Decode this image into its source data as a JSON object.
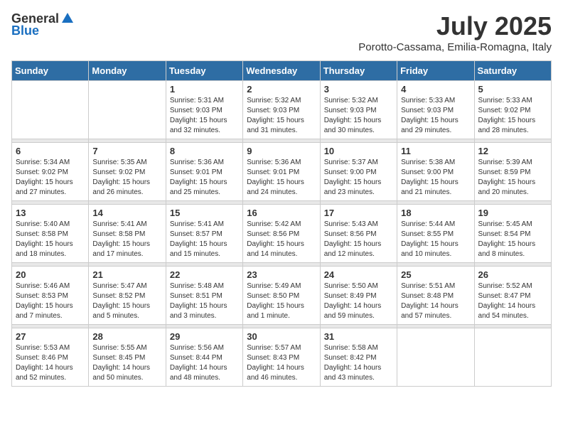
{
  "header": {
    "logo_general": "General",
    "logo_blue": "Blue",
    "month_year": "July 2025",
    "location": "Porotto-Cassama, Emilia-Romagna, Italy"
  },
  "weekdays": [
    "Sunday",
    "Monday",
    "Tuesday",
    "Wednesday",
    "Thursday",
    "Friday",
    "Saturday"
  ],
  "weeks": [
    [
      {
        "day": "",
        "sunrise": "",
        "sunset": "",
        "daylight": ""
      },
      {
        "day": "",
        "sunrise": "",
        "sunset": "",
        "daylight": ""
      },
      {
        "day": "1",
        "sunrise": "Sunrise: 5:31 AM",
        "sunset": "Sunset: 9:03 PM",
        "daylight": "Daylight: 15 hours and 32 minutes."
      },
      {
        "day": "2",
        "sunrise": "Sunrise: 5:32 AM",
        "sunset": "Sunset: 9:03 PM",
        "daylight": "Daylight: 15 hours and 31 minutes."
      },
      {
        "day": "3",
        "sunrise": "Sunrise: 5:32 AM",
        "sunset": "Sunset: 9:03 PM",
        "daylight": "Daylight: 15 hours and 30 minutes."
      },
      {
        "day": "4",
        "sunrise": "Sunrise: 5:33 AM",
        "sunset": "Sunset: 9:03 PM",
        "daylight": "Daylight: 15 hours and 29 minutes."
      },
      {
        "day": "5",
        "sunrise": "Sunrise: 5:33 AM",
        "sunset": "Sunset: 9:02 PM",
        "daylight": "Daylight: 15 hours and 28 minutes."
      }
    ],
    [
      {
        "day": "6",
        "sunrise": "Sunrise: 5:34 AM",
        "sunset": "Sunset: 9:02 PM",
        "daylight": "Daylight: 15 hours and 27 minutes."
      },
      {
        "day": "7",
        "sunrise": "Sunrise: 5:35 AM",
        "sunset": "Sunset: 9:02 PM",
        "daylight": "Daylight: 15 hours and 26 minutes."
      },
      {
        "day": "8",
        "sunrise": "Sunrise: 5:36 AM",
        "sunset": "Sunset: 9:01 PM",
        "daylight": "Daylight: 15 hours and 25 minutes."
      },
      {
        "day": "9",
        "sunrise": "Sunrise: 5:36 AM",
        "sunset": "Sunset: 9:01 PM",
        "daylight": "Daylight: 15 hours and 24 minutes."
      },
      {
        "day": "10",
        "sunrise": "Sunrise: 5:37 AM",
        "sunset": "Sunset: 9:00 PM",
        "daylight": "Daylight: 15 hours and 23 minutes."
      },
      {
        "day": "11",
        "sunrise": "Sunrise: 5:38 AM",
        "sunset": "Sunset: 9:00 PM",
        "daylight": "Daylight: 15 hours and 21 minutes."
      },
      {
        "day": "12",
        "sunrise": "Sunrise: 5:39 AM",
        "sunset": "Sunset: 8:59 PM",
        "daylight": "Daylight: 15 hours and 20 minutes."
      }
    ],
    [
      {
        "day": "13",
        "sunrise": "Sunrise: 5:40 AM",
        "sunset": "Sunset: 8:58 PM",
        "daylight": "Daylight: 15 hours and 18 minutes."
      },
      {
        "day": "14",
        "sunrise": "Sunrise: 5:41 AM",
        "sunset": "Sunset: 8:58 PM",
        "daylight": "Daylight: 15 hours and 17 minutes."
      },
      {
        "day": "15",
        "sunrise": "Sunrise: 5:41 AM",
        "sunset": "Sunset: 8:57 PM",
        "daylight": "Daylight: 15 hours and 15 minutes."
      },
      {
        "day": "16",
        "sunrise": "Sunrise: 5:42 AM",
        "sunset": "Sunset: 8:56 PM",
        "daylight": "Daylight: 15 hours and 14 minutes."
      },
      {
        "day": "17",
        "sunrise": "Sunrise: 5:43 AM",
        "sunset": "Sunset: 8:56 PM",
        "daylight": "Daylight: 15 hours and 12 minutes."
      },
      {
        "day": "18",
        "sunrise": "Sunrise: 5:44 AM",
        "sunset": "Sunset: 8:55 PM",
        "daylight": "Daylight: 15 hours and 10 minutes."
      },
      {
        "day": "19",
        "sunrise": "Sunrise: 5:45 AM",
        "sunset": "Sunset: 8:54 PM",
        "daylight": "Daylight: 15 hours and 8 minutes."
      }
    ],
    [
      {
        "day": "20",
        "sunrise": "Sunrise: 5:46 AM",
        "sunset": "Sunset: 8:53 PM",
        "daylight": "Daylight: 15 hours and 7 minutes."
      },
      {
        "day": "21",
        "sunrise": "Sunrise: 5:47 AM",
        "sunset": "Sunset: 8:52 PM",
        "daylight": "Daylight: 15 hours and 5 minutes."
      },
      {
        "day": "22",
        "sunrise": "Sunrise: 5:48 AM",
        "sunset": "Sunset: 8:51 PM",
        "daylight": "Daylight: 15 hours and 3 minutes."
      },
      {
        "day": "23",
        "sunrise": "Sunrise: 5:49 AM",
        "sunset": "Sunset: 8:50 PM",
        "daylight": "Daylight: 15 hours and 1 minute."
      },
      {
        "day": "24",
        "sunrise": "Sunrise: 5:50 AM",
        "sunset": "Sunset: 8:49 PM",
        "daylight": "Daylight: 14 hours and 59 minutes."
      },
      {
        "day": "25",
        "sunrise": "Sunrise: 5:51 AM",
        "sunset": "Sunset: 8:48 PM",
        "daylight": "Daylight: 14 hours and 57 minutes."
      },
      {
        "day": "26",
        "sunrise": "Sunrise: 5:52 AM",
        "sunset": "Sunset: 8:47 PM",
        "daylight": "Daylight: 14 hours and 54 minutes."
      }
    ],
    [
      {
        "day": "27",
        "sunrise": "Sunrise: 5:53 AM",
        "sunset": "Sunset: 8:46 PM",
        "daylight": "Daylight: 14 hours and 52 minutes."
      },
      {
        "day": "28",
        "sunrise": "Sunrise: 5:55 AM",
        "sunset": "Sunset: 8:45 PM",
        "daylight": "Daylight: 14 hours and 50 minutes."
      },
      {
        "day": "29",
        "sunrise": "Sunrise: 5:56 AM",
        "sunset": "Sunset: 8:44 PM",
        "daylight": "Daylight: 14 hours and 48 minutes."
      },
      {
        "day": "30",
        "sunrise": "Sunrise: 5:57 AM",
        "sunset": "Sunset: 8:43 PM",
        "daylight": "Daylight: 14 hours and 46 minutes."
      },
      {
        "day": "31",
        "sunrise": "Sunrise: 5:58 AM",
        "sunset": "Sunset: 8:42 PM",
        "daylight": "Daylight: 14 hours and 43 minutes."
      },
      {
        "day": "",
        "sunrise": "",
        "sunset": "",
        "daylight": ""
      },
      {
        "day": "",
        "sunrise": "",
        "sunset": "",
        "daylight": ""
      }
    ]
  ]
}
